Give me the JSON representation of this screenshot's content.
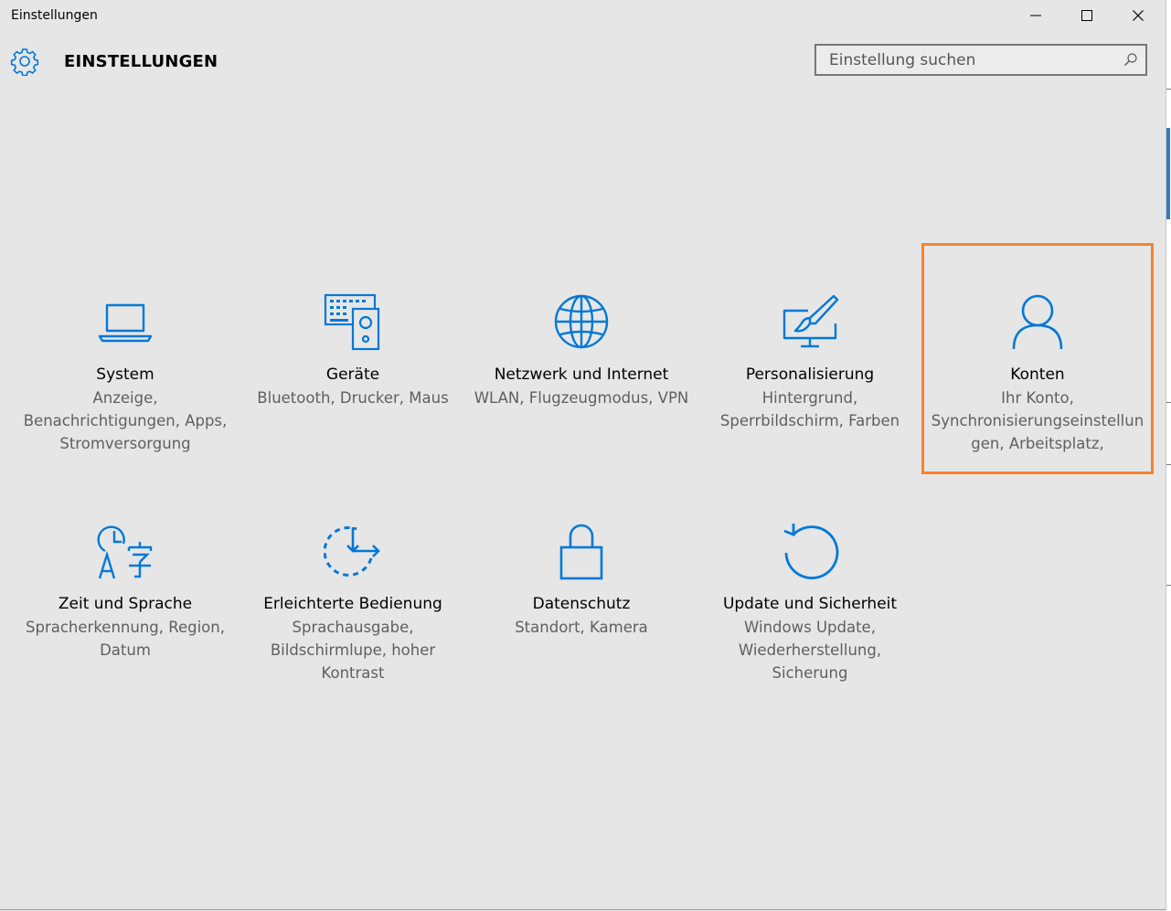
{
  "window": {
    "title": "Einstellungen",
    "minimize_label": "—",
    "maximize_label": "☐",
    "close_label": "✕"
  },
  "header": {
    "title": "EINSTELLUNGEN",
    "icon": "gear-icon"
  },
  "search": {
    "placeholder": "Einstellung suchen",
    "value": "",
    "icon": "search-icon"
  },
  "colors": {
    "accent": "#0078d7",
    "highlight": "#f5842b",
    "background": "#e6e6e6"
  },
  "tiles": [
    {
      "id": "system",
      "icon": "laptop-icon",
      "title": "System",
      "desc": "Anzeige, Benachrichtigungen, Apps, Stromversorgung"
    },
    {
      "id": "devices",
      "icon": "keyboard-speaker-icon",
      "title": "Geräte",
      "desc": "Bluetooth, Drucker, Maus"
    },
    {
      "id": "network",
      "icon": "globe-icon",
      "title": "Netzwerk und Internet",
      "desc": "WLAN, Flugzeugmodus, VPN"
    },
    {
      "id": "personalization",
      "icon": "paintbrush-monitor-icon",
      "title": "Personalisierung",
      "desc": "Hintergrund, Sperrbildschirm, Farben"
    },
    {
      "id": "accounts",
      "icon": "person-icon",
      "title": "Konten",
      "desc": "Ihr Konto, Synchronisierungseinstellungen, Arbeitsplatz,"
    },
    {
      "id": "time-language",
      "icon": "clock-language-icon",
      "title": "Zeit und Sprache",
      "desc": "Spracherkennung, Region, Datum"
    },
    {
      "id": "ease-of-access",
      "icon": "ease-of-access-icon",
      "title": "Erleichterte Bedienung",
      "desc": "Sprachausgabe, Bildschirmlupe, hoher Kontrast"
    },
    {
      "id": "privacy",
      "icon": "lock-icon",
      "title": "Datenschutz",
      "desc": "Standort, Kamera"
    },
    {
      "id": "update-security",
      "icon": "refresh-icon",
      "title": "Update und Sicherheit",
      "desc": "Windows Update, Wiederherstellung, Sicherung"
    }
  ]
}
